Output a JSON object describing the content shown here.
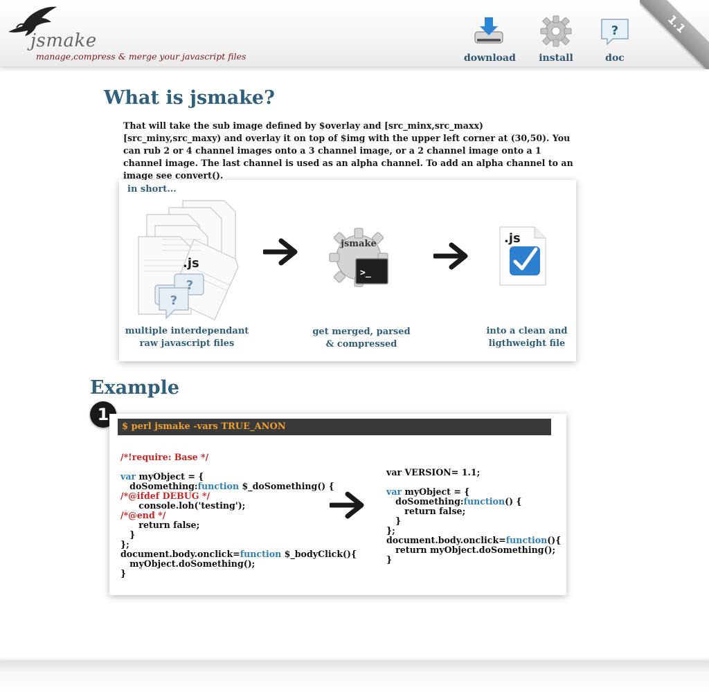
{
  "header": {
    "logo_name": "jsmake",
    "tagline": "manage,compress & merge your javascript files",
    "nav": [
      {
        "label": "download",
        "icon": "download-drive-icon"
      },
      {
        "label": "install",
        "icon": "gear-icon"
      },
      {
        "label": "doc",
        "icon": "question-bubble-icon"
      }
    ],
    "version_ribbon": "1.1"
  },
  "what": {
    "title": "What is jsmake?",
    "intro": "That will take the sub image defined by $overlay and [src_minx,src_maxx)[src_miny,src_maxy) and overlay it on top of $img  with the upper left corner at (30,50). You can rub 2 or 4 channel images onto a 3 channel image, or a 2 channel image onto a 1 channel image. The last channel is used as an alpha channel. To add an alpha channel to an image see convert().",
    "in_short": "in short...",
    "steps": [
      {
        "caption_line1": "multiple interdependant",
        "caption_line2": "raw javascript files",
        "badge": ".js",
        "question_mark": "?"
      },
      {
        "caption_line1": "get merged, parsed",
        "caption_line2": "& compressed",
        "badge": "jsmake",
        "prompt": ">_"
      },
      {
        "caption_line1": "into a clean and",
        "caption_line2": "ligthweight file",
        "badge": ".js"
      }
    ]
  },
  "example": {
    "title": "Example",
    "step_number": "1",
    "command": "$ perl jsmake  -vars TRUE_ANON",
    "left_code": [
      {
        "type": "pp",
        "text": "/*!require: Base */"
      },
      {
        "type": "blank",
        "text": ""
      },
      {
        "type": "mixed",
        "parts": [
          {
            "c": "kw",
            "t": "var"
          },
          {
            "c": "",
            "t": " myObject = {"
          }
        ]
      },
      {
        "type": "mixed",
        "parts": [
          {
            "c": "",
            "t": "   doSomething:"
          },
          {
            "c": "kw",
            "t": "function"
          },
          {
            "c": "",
            "t": " $_doSomething() {"
          }
        ]
      },
      {
        "type": "pp",
        "text": "/*@ifdef DEBUG */"
      },
      {
        "type": "plain",
        "text": "      console.loh('testing');"
      },
      {
        "type": "pp",
        "text": "/*@end */"
      },
      {
        "type": "plain",
        "text": "      return false;"
      },
      {
        "type": "plain",
        "text": "   }"
      },
      {
        "type": "plain",
        "text": "};"
      },
      {
        "type": "mixed",
        "parts": [
          {
            "c": "",
            "t": "document.body.onclick="
          },
          {
            "c": "kw",
            "t": "function"
          },
          {
            "c": "",
            "t": " $_bodyClick(){"
          }
        ]
      },
      {
        "type": "plain",
        "text": "   myObject.doSomething();"
      },
      {
        "type": "plain",
        "text": "}"
      }
    ],
    "right_code": [
      {
        "type": "plain",
        "text": "var VERSION= 1.1;"
      },
      {
        "type": "blank",
        "text": ""
      },
      {
        "type": "mixed",
        "parts": [
          {
            "c": "kw",
            "t": "var"
          },
          {
            "c": "",
            "t": " myObject = {"
          }
        ]
      },
      {
        "type": "mixed",
        "parts": [
          {
            "c": "",
            "t": "   doSomething:"
          },
          {
            "c": "kw",
            "t": "function"
          },
          {
            "c": "",
            "t": "() {"
          }
        ]
      },
      {
        "type": "plain",
        "text": "      return false;"
      },
      {
        "type": "plain",
        "text": "   }"
      },
      {
        "type": "plain",
        "text": "};"
      },
      {
        "type": "mixed",
        "parts": [
          {
            "c": "",
            "t": "document.body.onclick="
          },
          {
            "c": "kw",
            "t": "function"
          },
          {
            "c": "",
            "t": "(){"
          }
        ]
      },
      {
        "type": "plain",
        "text": "   return myObject.doSomething();"
      },
      {
        "type": "plain",
        "text": "}"
      }
    ]
  },
  "colors": {
    "heading": "#2f5f7a",
    "keyword": "#2c7fb8",
    "preprocessor": "#cc2222",
    "command_text": "#f0a030",
    "tagline": "#7a1a1a"
  }
}
